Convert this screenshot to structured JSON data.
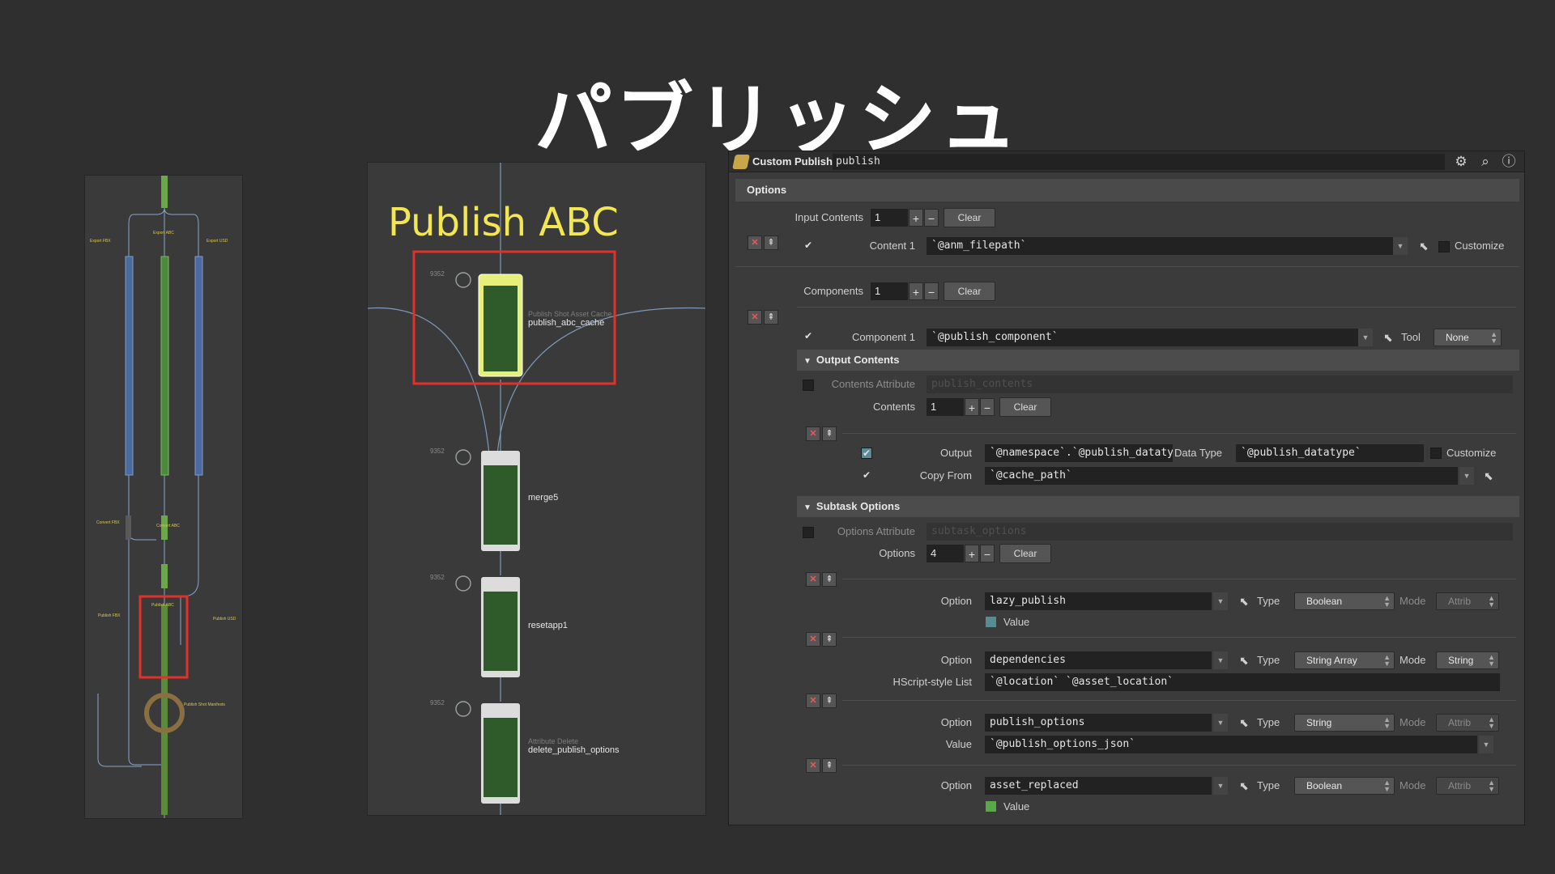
{
  "slide": {
    "title": "パブリッシュ"
  },
  "overview": {
    "labels": {
      "export_fbx": "Export FBX",
      "export_abc": "Export ABC",
      "export_usd": "Export USD",
      "convert_fbx": "Convert FBX",
      "convert_abc": "Convert ABC",
      "publish_fbx": "Publish FBX",
      "publish_abc": "Publish ABC",
      "publish_usd": "Publish USD",
      "publish_manifests": "Publish Shot Manifests"
    }
  },
  "network": {
    "title": "Publish ABC",
    "nodes": [
      {
        "num": "9352",
        "type": "Publish Shot Asset Cache",
        "name": "publish_abc_cache"
      },
      {
        "num": "9352",
        "type": "",
        "name": "merge5"
      },
      {
        "num": "9352",
        "type": "",
        "name": "resetapp1"
      },
      {
        "num": "9352",
        "type": "Attribute Delete",
        "name": "delete_publish_options"
      }
    ]
  },
  "panel": {
    "op_type": "Custom Publish",
    "op_name": "publish",
    "header_icons": [
      "gear-icon",
      "search-icon",
      "info-icon"
    ],
    "options_section": "Options",
    "input_contents": {
      "label": "Input Contents",
      "count": "1",
      "clear": "Clear"
    },
    "content1": {
      "label": "Content 1",
      "value": "`@anm_filepath`",
      "customize": "Customize"
    },
    "components": {
      "label": "Components",
      "count": "1",
      "clear": "Clear"
    },
    "component1": {
      "label": "Component 1",
      "value": "`@publish_component`",
      "tool_label": "Tool",
      "tool_value": "None"
    },
    "output_contents": {
      "title": "Output Contents",
      "attr_label": "Contents Attribute",
      "attr_placeholder": "publish_contents",
      "count_label": "Contents",
      "count": "1",
      "clear": "Clear",
      "output_label": "Output",
      "output_value": "`@namespace`.`@publish_datatype`",
      "datatype_label": "Data Type",
      "datatype_value": "`@publish_datatype`",
      "customize": "Customize",
      "copyfrom_label": "Copy From",
      "copyfrom_value": "`@cache_path`"
    },
    "subtask_options": {
      "title": "Subtask Options",
      "attr_label": "Options Attribute",
      "attr_placeholder": "subtask_options",
      "count_label": "Options",
      "count": "4",
      "clear": "Clear",
      "option_label": "Option",
      "type_label": "Type",
      "mode_label": "Mode",
      "items": [
        {
          "name": "lazy_publish",
          "type": "Boolean",
          "mode": "Attrib",
          "extra_label": "Value",
          "extra_value": "",
          "color": "#5a8a92"
        },
        {
          "name": "dependencies",
          "type": "String Array",
          "mode": "String",
          "extra_label": "HScript-style List",
          "extra_value": "`@location` `@asset_location`"
        },
        {
          "name": "publish_options",
          "type": "String",
          "mode": "Attrib",
          "extra_label": "Value",
          "extra_value": "`@publish_options_json`"
        },
        {
          "name": "asset_replaced",
          "type": "Boolean",
          "mode": "Attrib",
          "extra_label": "Value",
          "extra_value": "",
          "color": "#5aa84a"
        }
      ]
    }
  }
}
